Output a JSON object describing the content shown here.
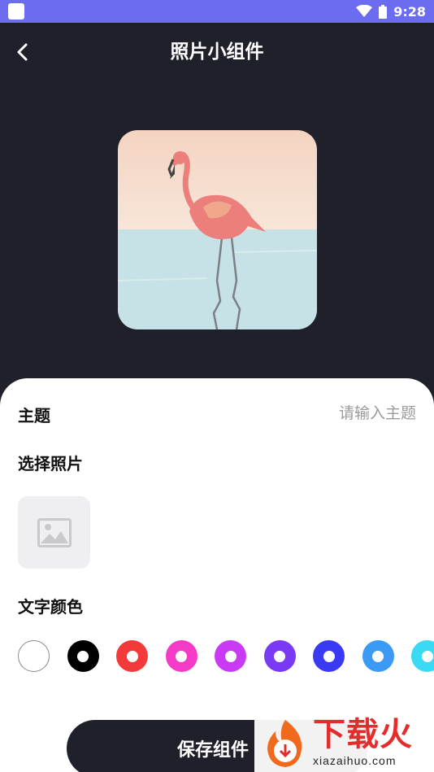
{
  "status_bar": {
    "time": "9:28",
    "icons": [
      "app-icon",
      "wifi-icon",
      "battery-icon"
    ]
  },
  "header": {
    "title": "照片小组件",
    "back_icon": "chevron-left-icon"
  },
  "preview": {
    "image": "flamingo-illustration"
  },
  "form": {
    "subject_label": "主题",
    "subject_placeholder": "请输入主题",
    "subject_value": "",
    "photo_label": "选择照片",
    "photo_picker_icon": "image-placeholder-icon",
    "color_label": "文字颜色"
  },
  "colors": [
    "#ffffff",
    "#000000",
    "#f23a3a",
    "#f43ac6",
    "#c93af4",
    "#7a3af4",
    "#3a3af4",
    "#3a9af4",
    "#3ad9f4"
  ],
  "actions": {
    "save_label": "保存组件"
  },
  "watermark": {
    "text_cn": "下载火",
    "text_en": "xiazaihuo.com"
  }
}
